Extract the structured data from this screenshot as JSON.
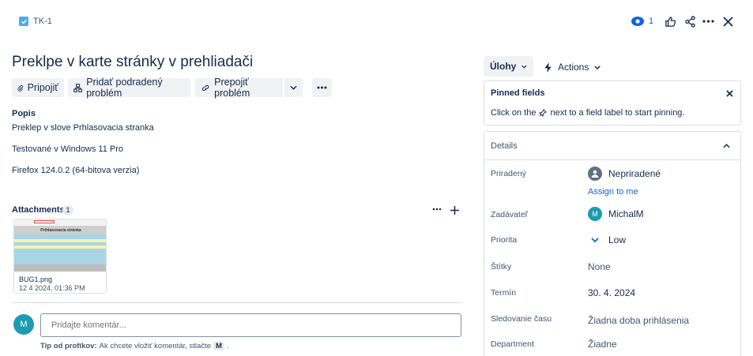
{
  "issue_key": "TK-1",
  "watch_count": "1",
  "title": "Preklpe v karte stránky v prehliadači",
  "toolbar": {
    "attach_label": "Pripojiť",
    "add_child_label": "Pridať podradený problém",
    "link_label": "Prepojiť problém"
  },
  "description": {
    "heading": "Popis",
    "lines": [
      "Preklep v slove Prhlasovacia stranka",
      "Testované v Windows 11 Pro",
      "Firefox 124.0.2 (64-bitova verzia)"
    ]
  },
  "attachments": {
    "heading": "Attachments",
    "count": "1",
    "thumb_title": "Prihlasovacia stránka",
    "file_name": "BUG1.png",
    "file_date": "12 4 2024, 01:36 PM"
  },
  "comment": {
    "avatar": "M",
    "placeholder": "Pridajte komentár...",
    "tip_bold": "Tip od profíkov:",
    "tip_text": "Ak chcete vložiť komentár, stlačte",
    "tip_key": "M",
    "tip_end": "."
  },
  "sidebar": {
    "status_label": "Úlohy",
    "actions_label": "Actions",
    "pinned": {
      "title": "Pinned fields",
      "text_before": "Click on the",
      "text_after": "next to a field label to start pinning."
    },
    "details_title": "Details",
    "fields": [
      {
        "label": "Priradený",
        "value": "Nepriradené",
        "extra": "Assign to me"
      },
      {
        "label": "Zadávateľ",
        "value": "MichalM",
        "avatar": "M"
      },
      {
        "label": "Priorita",
        "value": "Low"
      },
      {
        "label": "Štítky",
        "value": "None"
      },
      {
        "label": "Termín",
        "value": "30. 4. 2024"
      },
      {
        "label": "Sledovanie času",
        "value": "Žiadna doba prihlásenia"
      },
      {
        "label": "Department",
        "value": "Žiadne"
      }
    ]
  },
  "colors": {
    "brand": "#0c66e4",
    "avatar": "#1d9bb2",
    "checkbox": "#4bade8"
  }
}
